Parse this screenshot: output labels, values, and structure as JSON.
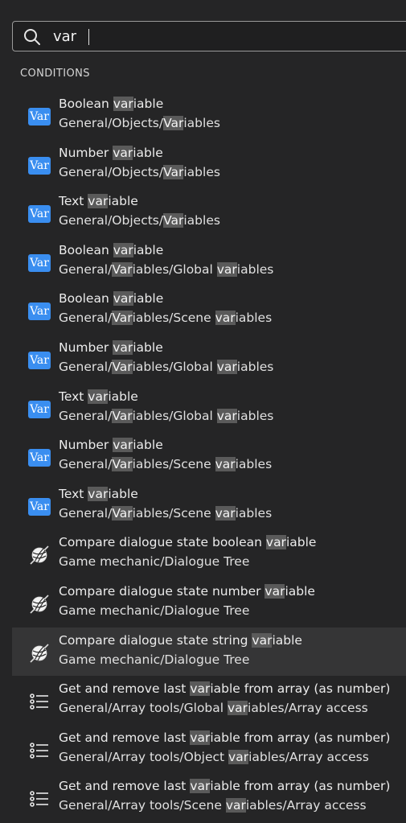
{
  "search": {
    "value": "var",
    "placeholder": ""
  },
  "section_label": "CONDITIONS",
  "highlight": "var",
  "icon_texts": {
    "variable": "Var"
  },
  "colors": {
    "background": "#252526",
    "highlight": "#5a5a5a",
    "var_icon": "#3a8ef0",
    "selected_row": "#353536"
  },
  "items": [
    {
      "icon": "variable-icon",
      "title": "Boolean variable",
      "path": "General/Objects/Variables",
      "selected": false
    },
    {
      "icon": "variable-icon",
      "title": "Number variable",
      "path": "General/Objects/Variables",
      "selected": false
    },
    {
      "icon": "variable-icon",
      "title": "Text variable",
      "path": "General/Objects/Variables",
      "selected": false
    },
    {
      "icon": "variable-icon",
      "title": "Boolean variable",
      "path": "General/Variables/Global variables",
      "selected": false
    },
    {
      "icon": "variable-icon",
      "title": "Boolean variable",
      "path": "General/Variables/Scene variables",
      "selected": false
    },
    {
      "icon": "variable-icon",
      "title": "Number variable",
      "path": "General/Variables/Global variables",
      "selected": false
    },
    {
      "icon": "variable-icon",
      "title": "Text variable",
      "path": "General/Variables/Global variables",
      "selected": false
    },
    {
      "icon": "variable-icon",
      "title": "Number variable",
      "path": "General/Variables/Scene variables",
      "selected": false
    },
    {
      "icon": "variable-icon",
      "title": "Text variable",
      "path": "General/Variables/Scene variables",
      "selected": false
    },
    {
      "icon": "yarn-ball-icon",
      "title": "Compare dialogue state boolean variable",
      "path": "Game mechanic/Dialogue Tree",
      "selected": false
    },
    {
      "icon": "yarn-ball-icon",
      "title": "Compare dialogue state number variable",
      "path": "Game mechanic/Dialogue Tree",
      "selected": false
    },
    {
      "icon": "yarn-ball-icon",
      "title": "Compare dialogue state string variable",
      "path": "Game mechanic/Dialogue Tree",
      "selected": true
    },
    {
      "icon": "list-icon",
      "title": "Get and remove last variable from array (as number)",
      "path": "General/Array tools/Global variables/Array access",
      "selected": false
    },
    {
      "icon": "list-icon",
      "title": "Get and remove last variable from array (as number)",
      "path": "General/Array tools/Object variables/Array access",
      "selected": false
    },
    {
      "icon": "list-icon",
      "title": "Get and remove last variable from array (as number)",
      "path": "General/Array tools/Scene variables/Array access",
      "selected": false
    }
  ]
}
